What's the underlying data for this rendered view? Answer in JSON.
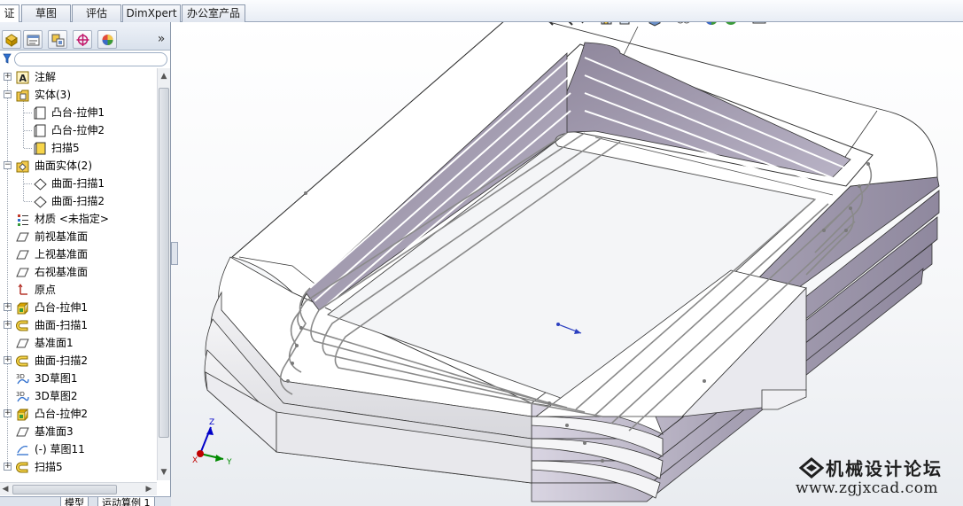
{
  "command_tabs": [
    {
      "label": "证",
      "active": true
    },
    {
      "label": "草图",
      "active": false
    },
    {
      "label": "评估",
      "active": false
    },
    {
      "label": "DimXpert",
      "active": false
    },
    {
      "label": "办公室产品",
      "active": false
    }
  ],
  "panel": {
    "tabs": [
      "feature-manager",
      "property-manager",
      "configuration-manager",
      "dimxpert-manager",
      "display-manager"
    ],
    "more_glyph": "»"
  },
  "tree": [
    {
      "label": "注解",
      "icon": "annotation-icon",
      "expander": "+"
    },
    {
      "label": "实体(3)",
      "icon": "solid-bodies-folder-icon",
      "expander": "−"
    },
    {
      "label": "凸台-拉伸1",
      "icon": "solid-body-icon"
    },
    {
      "label": "凸台-拉伸2",
      "icon": "solid-body-icon"
    },
    {
      "label": "扫描5",
      "icon": "solid-body-selected-icon"
    },
    {
      "label": "曲面实体(2)",
      "icon": "surface-bodies-folder-icon",
      "expander": "−"
    },
    {
      "label": "曲面-扫描1",
      "icon": "surface-body-icon"
    },
    {
      "label": "曲面-扫描2",
      "icon": "surface-body-icon"
    },
    {
      "label": "材质 <未指定>",
      "icon": "material-icon"
    },
    {
      "label": "前视基准面",
      "icon": "plane-icon"
    },
    {
      "label": "上视基准面",
      "icon": "plane-icon"
    },
    {
      "label": "右视基准面",
      "icon": "plane-icon"
    },
    {
      "label": "原点",
      "icon": "origin-icon"
    },
    {
      "label": "凸台-拉伸1",
      "icon": "extrude-icon",
      "expander": "+"
    },
    {
      "label": "曲面-扫描1",
      "icon": "surface-sweep-icon",
      "expander": "+"
    },
    {
      "label": "基准面1",
      "icon": "plane-icon"
    },
    {
      "label": "曲面-扫描2",
      "icon": "surface-sweep-icon",
      "expander": "+"
    },
    {
      "label": "3D草图1",
      "icon": "3d-sketch-icon"
    },
    {
      "label": "3D草图2",
      "icon": "3d-sketch-icon"
    },
    {
      "label": "凸台-拉伸2",
      "icon": "extrude-icon",
      "expander": "+"
    },
    {
      "label": "基准面3",
      "icon": "plane-icon"
    },
    {
      "label": "(-) 草图11",
      "icon": "sketch-icon"
    },
    {
      "label": "扫描5",
      "icon": "sweep-icon",
      "expander": "+"
    }
  ],
  "bottom_tabs": [
    "模型",
    "运动算例 1"
  ],
  "triad": {
    "x": "X",
    "y": "Y",
    "z": "Z"
  },
  "watermark": {
    "title": "机械设计论坛",
    "url": "www.zgjxcad.com"
  },
  "colors": {
    "panel_border": "#8b98ab",
    "model_face": "#ffffff",
    "model_side": "#a7a1b4",
    "triad_x": "#c00000",
    "triad_y": "#008a00",
    "triad_z": "#0000c8"
  }
}
